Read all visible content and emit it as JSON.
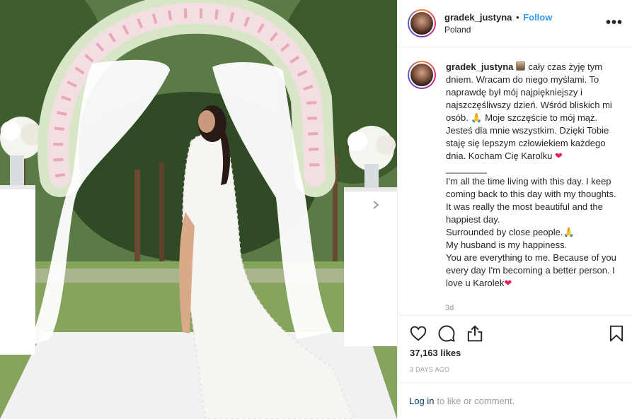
{
  "post": {
    "username": "gradek_justyna",
    "separator": "•",
    "follow_label": "Follow",
    "location": "Poland",
    "more_label": "•••",
    "caption_pl": "cały czas żyję tym dniem. Wracam do niego myślami. To naprawdę był mój najpiękniejszy i najszczęśliwszy dzień. Wśród bliskich mi osób. 🙏 Moje szczęście to mój mąż. Jesteś dla mnie wszystkim. Dzięki Tobie staję się lepszym człowiekiem każdego dnia. Kocham Cię Karolku",
    "divider": "________",
    "caption_en": "I'm all the time living with this day. I keep coming back to this day with my thoughts. It was really the most beautiful and the happiest day.\nSurrounded by close people.🙏\nMy husband is my happiness.\nYou are everything to me. Because of you every day I'm becoming a better person. I love u Karolek",
    "heart": "❤",
    "time_ago": "3d",
    "likes": "37,163 likes",
    "date": "3 DAYS AGO"
  },
  "login": {
    "link": "Log in",
    "rest": "to like or comment."
  },
  "icons": {
    "like": "heart-outline-icon",
    "comment": "comment-bubble-icon",
    "share": "share-icon",
    "save": "bookmark-icon",
    "next": "chevron-right-icon"
  },
  "colors": {
    "link_blue": "#3897f0",
    "heart_red": "#e0245e",
    "muted": "#999999",
    "login_link": "#003569"
  }
}
